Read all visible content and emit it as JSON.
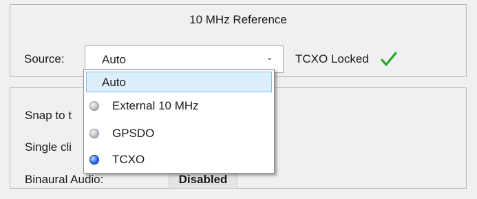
{
  "reference": {
    "title": "10 MHz Reference",
    "source_label": "Source:",
    "source_value": "Auto",
    "status_text": "TCXO Locked",
    "status_color": "#22a722"
  },
  "options": {
    "snap_label": "Snap to t",
    "single_click_label": "Single cli",
    "binaural_label": "Binaural Audio:",
    "binaural_value": "Disabled"
  },
  "dropdown": {
    "items": [
      {
        "label": "Auto",
        "icon": null,
        "selected": true
      },
      {
        "label": "External 10 MHz",
        "icon": "radio-inactive-icon",
        "selected": false
      },
      {
        "label": "GPSDO",
        "icon": "radio-inactive-icon",
        "selected": false
      },
      {
        "label": "TCXO",
        "icon": "radio-active-icon",
        "selected": false
      }
    ]
  }
}
